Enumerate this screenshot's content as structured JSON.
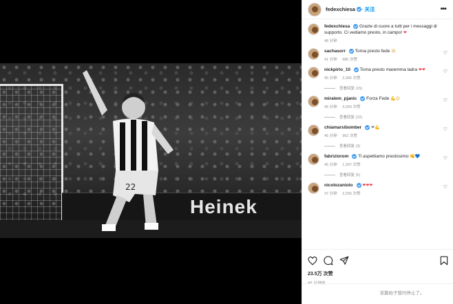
{
  "post": {
    "username": "fedexchiesa",
    "follow_label": "· 关注",
    "caption": "Grazie di cuore a tutti per i messaggi di supporto. Ci vediamo presto, in campo!",
    "caption_emoji": "❤",
    "caption_time": "48 分钟",
    "board_text": "Heinek"
  },
  "comments": [
    {
      "user": "sachasorr",
      "text": "Torna presto fede",
      "emoji": "😢",
      "time": "41 分钟",
      "likes": "685 次赞",
      "replies": ""
    },
    {
      "user": "nickpirlo_10",
      "text": "Torna presto maremma ladra",
      "emoji": "❤❤",
      "time": "45 分钟",
      "likes": "2,366 次赞",
      "replies": "查看回复 (15)"
    },
    {
      "user": "miralem_pjanic",
      "text": "Forza Fede",
      "emoji": "💪😉",
      "time": "45 分钟",
      "likes": "3,093 次赞",
      "replies": "查看回复 (22)"
    },
    {
      "user": "chiamarsibomber",
      "text": "",
      "emoji": "❤💪",
      "time": "45 分钟",
      "likes": "962 次赞",
      "replies": "查看回复 (3)"
    },
    {
      "user": "fabriziorom",
      "text": "Ti aspettiamo prestissimo",
      "emoji": "👊💙",
      "time": "45 分钟",
      "likes": "1,307 次赞",
      "replies": "查看回复 (5)"
    },
    {
      "user": "nicolozaniolo",
      "text": "",
      "emoji": "❤❤❤",
      "time": "37 分钟",
      "likes": "2,256 次赞",
      "replies": ""
    }
  ],
  "footer": {
    "likes": "23.5万 次赞",
    "time": "48 分钟前",
    "comments_closed": "该篇帖子暂时停止了。"
  },
  "colors": {
    "accent": "#0095f6",
    "verified": "#3897f0",
    "muted": "#8e8e8e",
    "heart": "#ed4956"
  }
}
